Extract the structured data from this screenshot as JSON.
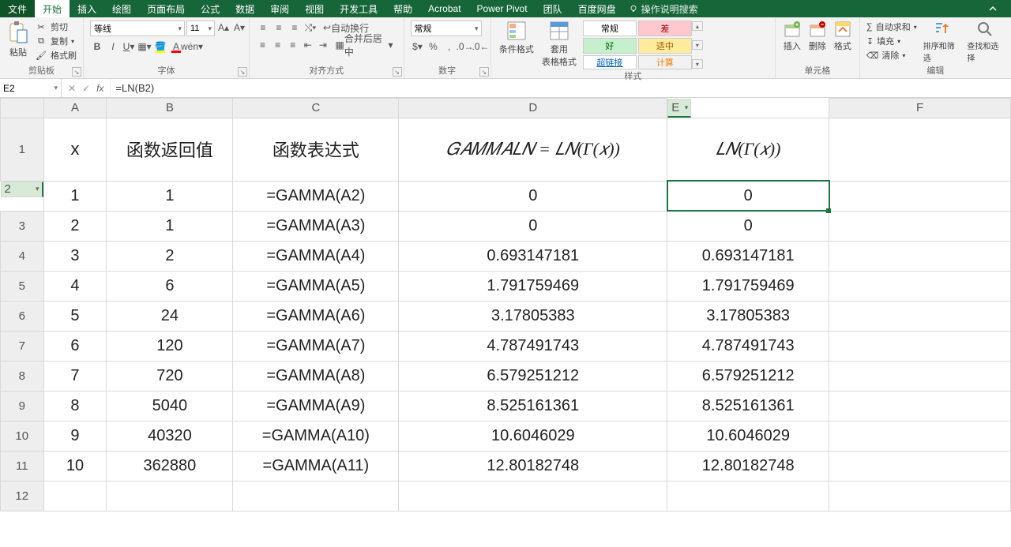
{
  "tabs": {
    "file": "文件",
    "list": [
      "开始",
      "插入",
      "绘图",
      "页面布局",
      "公式",
      "数据",
      "审阅",
      "视图",
      "开发工具",
      "帮助",
      "Acrobat",
      "Power Pivot",
      "团队",
      "百度网盘"
    ],
    "active": "开始",
    "tell": "操作说明搜索"
  },
  "ribbon": {
    "clipboard": {
      "label": "剪贴板",
      "paste": "粘贴",
      "cut": "剪切",
      "copy": "复制",
      "fmtpaint": "格式刷"
    },
    "font": {
      "label": "字体",
      "name": "等线",
      "size": "11"
    },
    "align": {
      "label": "对齐方式",
      "wrap": "自动换行",
      "merge": "合并后居中"
    },
    "number": {
      "label": "数字",
      "fmt": "常规"
    },
    "styles": {
      "label": "样式",
      "condfmt": "条件格式",
      "tablefmt": "套用\n表格格式",
      "normal": "常规",
      "bad": "差",
      "good": "好",
      "mid": "适中",
      "link": "超链接",
      "calc": "计算"
    },
    "cells": {
      "label": "单元格",
      "insert": "插入",
      "delete": "删除",
      "format": "格式"
    },
    "editing": {
      "label": "编辑",
      "sum": "自动求和",
      "fill": "填充",
      "clear": "清除",
      "sort": "排序和筛选",
      "find": "查找和选择"
    }
  },
  "formula_bar": {
    "cell": "E2",
    "formula": "=LN(B2)"
  },
  "columns": [
    "A",
    "B",
    "C",
    "D",
    "E",
    "F"
  ],
  "header_row": {
    "A": "x",
    "B": "函数返回值",
    "C": "函数表达式",
    "D": "𝐺𝐴𝑀𝑀𝐴𝐿𝑁 = 𝐿𝑁(Γ(𝑥))",
    "E": "𝐿𝑁(Γ(𝑥))"
  },
  "rows": [
    {
      "n": "2",
      "A": "1",
      "B": "1",
      "C": "=GAMMA(A2)",
      "D": "0",
      "E": "0"
    },
    {
      "n": "3",
      "A": "2",
      "B": "1",
      "C": "=GAMMA(A3)",
      "D": "0",
      "E": "0"
    },
    {
      "n": "4",
      "A": "3",
      "B": "2",
      "C": "=GAMMA(A4)",
      "D": "0.693147181",
      "E": "0.693147181"
    },
    {
      "n": "5",
      "A": "4",
      "B": "6",
      "C": "=GAMMA(A5)",
      "D": "1.791759469",
      "E": "1.791759469"
    },
    {
      "n": "6",
      "A": "5",
      "B": "24",
      "C": "=GAMMA(A6)",
      "D": "3.17805383",
      "E": "3.17805383"
    },
    {
      "n": "7",
      "A": "6",
      "B": "120",
      "C": "=GAMMA(A7)",
      "D": "4.787491743",
      "E": "4.787491743"
    },
    {
      "n": "8",
      "A": "7",
      "B": "720",
      "C": "=GAMMA(A8)",
      "D": "6.579251212",
      "E": "6.579251212"
    },
    {
      "n": "9",
      "A": "8",
      "B": "5040",
      "C": "=GAMMA(A9)",
      "D": "8.525161361",
      "E": "8.525161361"
    },
    {
      "n": "10",
      "A": "9",
      "B": "40320",
      "C": "=GAMMA(A10)",
      "D": "10.6046029",
      "E": "10.6046029"
    },
    {
      "n": "11",
      "A": "10",
      "B": "362880",
      "C": "=GAMMA(A11)",
      "D": "12.80182748",
      "E": "12.80182748"
    }
  ],
  "empty_row": "12",
  "active_cell": "E2"
}
